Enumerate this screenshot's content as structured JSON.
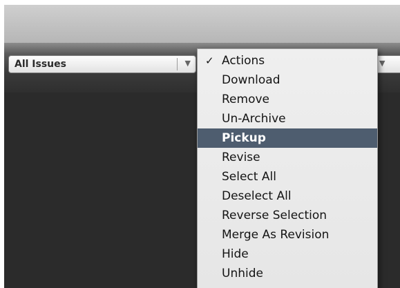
{
  "toolbar": {
    "filter_popup": {
      "selected": "All Issues",
      "arrow_icon": "popup-down-arrow-icon"
    }
  },
  "actions_menu": {
    "check_glyph": "✓",
    "items": [
      {
        "label": "Actions",
        "checked": true
      },
      {
        "label": "Download"
      },
      {
        "label": "Remove"
      },
      {
        "label": "Un-Archive"
      },
      {
        "label": "Pickup",
        "highlighted": true
      },
      {
        "label": "Revise"
      },
      {
        "label": "Select All"
      },
      {
        "label": "Deselect All"
      },
      {
        "label": "Reverse Selection"
      },
      {
        "label": "Merge As Revision"
      },
      {
        "label": "Hide"
      },
      {
        "label": "Unhide"
      }
    ]
  },
  "colors": {
    "highlight": "#4e5d6f",
    "menu_background": "#ececec",
    "content_background": "#2b2b2b"
  }
}
